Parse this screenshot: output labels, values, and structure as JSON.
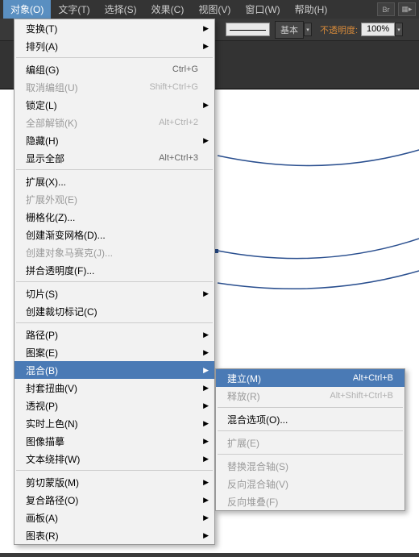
{
  "menubar": {
    "items": [
      "对象(O)",
      "文字(T)",
      "选择(S)",
      "效果(C)",
      "视图(V)",
      "窗口(W)",
      "帮助(H)"
    ],
    "br": "Br"
  },
  "toolbar": {
    "basic": "基本",
    "opacity_label": "不透明度:",
    "opacity_value": "100%"
  },
  "menu": [
    {
      "t": "it",
      "lb": "变换(T)",
      "ar": 1
    },
    {
      "t": "it",
      "lb": "排列(A)",
      "ar": 1
    },
    {
      "t": "sep"
    },
    {
      "t": "it",
      "lb": "编组(G)",
      "sc": "Ctrl+G"
    },
    {
      "t": "it",
      "lb": "取消编组(U)",
      "sc": "Shift+Ctrl+G",
      "dis": 1
    },
    {
      "t": "it",
      "lb": "锁定(L)",
      "ar": 1
    },
    {
      "t": "it",
      "lb": "全部解锁(K)",
      "sc": "Alt+Ctrl+2",
      "dis": 1
    },
    {
      "t": "it",
      "lb": "隐藏(H)",
      "ar": 1
    },
    {
      "t": "it",
      "lb": "显示全部",
      "sc": "Alt+Ctrl+3"
    },
    {
      "t": "sep"
    },
    {
      "t": "it",
      "lb": "扩展(X)..."
    },
    {
      "t": "it",
      "lb": "扩展外观(E)",
      "dis": 1
    },
    {
      "t": "it",
      "lb": "栅格化(Z)..."
    },
    {
      "t": "it",
      "lb": "创建渐变网格(D)..."
    },
    {
      "t": "it",
      "lb": "创建对象马赛克(J)...",
      "dis": 1
    },
    {
      "t": "it",
      "lb": "拼合透明度(F)..."
    },
    {
      "t": "sep"
    },
    {
      "t": "it",
      "lb": "切片(S)",
      "ar": 1
    },
    {
      "t": "it",
      "lb": "创建裁切标记(C)"
    },
    {
      "t": "sep"
    },
    {
      "t": "it",
      "lb": "路径(P)",
      "ar": 1
    },
    {
      "t": "it",
      "lb": "图案(E)",
      "ar": 1
    },
    {
      "t": "it",
      "lb": "混合(B)",
      "ar": 1,
      "hl": 1
    },
    {
      "t": "it",
      "lb": "封套扭曲(V)",
      "ar": 1
    },
    {
      "t": "it",
      "lb": "透视(P)",
      "ar": 1
    },
    {
      "t": "it",
      "lb": "实时上色(N)",
      "ar": 1
    },
    {
      "t": "it",
      "lb": "图像描摹",
      "ar": 1
    },
    {
      "t": "it",
      "lb": "文本绕排(W)",
      "ar": 1
    },
    {
      "t": "sep"
    },
    {
      "t": "it",
      "lb": "剪切蒙版(M)",
      "ar": 1
    },
    {
      "t": "it",
      "lb": "复合路径(O)",
      "ar": 1
    },
    {
      "t": "it",
      "lb": "画板(A)",
      "ar": 1
    },
    {
      "t": "it",
      "lb": "图表(R)",
      "ar": 1
    }
  ],
  "sub": [
    {
      "t": "it",
      "lb": "建立(M)",
      "sc": "Alt+Ctrl+B",
      "hl": 1
    },
    {
      "t": "it",
      "lb": "释放(R)",
      "sc": "Alt+Shift+Ctrl+B",
      "dis": 1
    },
    {
      "t": "sep"
    },
    {
      "t": "it",
      "lb": "混合选项(O)..."
    },
    {
      "t": "sep"
    },
    {
      "t": "it",
      "lb": "扩展(E)",
      "dis": 1
    },
    {
      "t": "sep"
    },
    {
      "t": "it",
      "lb": "替换混合轴(S)",
      "dis": 1
    },
    {
      "t": "it",
      "lb": "反向混合轴(V)",
      "dis": 1
    },
    {
      "t": "it",
      "lb": "反向堆叠(F)",
      "dis": 1
    }
  ]
}
